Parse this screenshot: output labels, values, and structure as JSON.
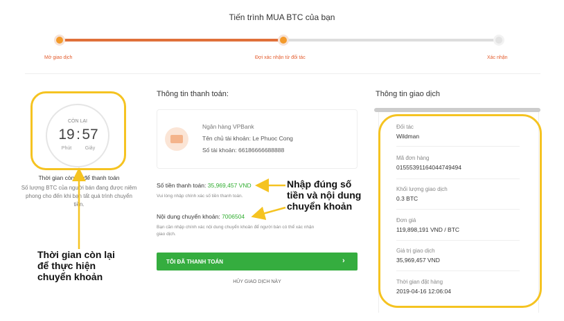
{
  "header": {
    "title": "Tiến trình MUA BTC của bạn"
  },
  "progress": {
    "fraction": 0.5,
    "steps": [
      {
        "label": "Mở giao dịch",
        "state": "done"
      },
      {
        "label": "Đợi xác nhận từ đối tác",
        "state": "current"
      },
      {
        "label": "Xác nhận",
        "state": "pending"
      }
    ]
  },
  "timer": {
    "label": "CÒN LẠI",
    "minutes": "19",
    "separator": ":",
    "seconds": "57",
    "minutes_unit": "Phút",
    "seconds_unit": "Giây",
    "heading": "Thời gian còn lại để thanh toán",
    "description": "Số lượng BTC của người bán đang được niêm phong cho đến khi bạn tất quá trình chuyển tiền."
  },
  "payment": {
    "title": "Thông tin thanh toán:",
    "bank_name": "Ngân hàng VPBank",
    "holder_label": "Tên chủ tài khoản:",
    "holder_value": "Le Phuoc Cong",
    "account_label": "Số tài khoản:",
    "account_value": "66186666688888",
    "amount_label": "Số tiền thanh toán:",
    "amount_value": "35,969,457 VND",
    "amount_note": "Vui lòng nhập chính xác số tiền thanh toán.",
    "content_label": "Nội dung chuyển khoản:",
    "content_value": "7006504",
    "content_note_1": "Bạn cần nhập chính xác nội dung chuyển khoản để người bán có thể xác nhận",
    "content_note_2": "giao dịch.",
    "pay_button": "TÔI ĐÃ THANH TOÁN",
    "pay_arrow": "›",
    "cancel_link": "HỦY GIAO DỊCH NÀY"
  },
  "transaction": {
    "title": "Thông tin giao dịch",
    "fields": [
      {
        "label": "Đối tác",
        "value": "Wildman"
      },
      {
        "label": "Mã đơn hàng",
        "value": "015553911640447494​94"
      },
      {
        "label": "Khối lượng giao dịch",
        "value": "0.3 BTC"
      },
      {
        "label": "Đơn giá",
        "value": "119,898,191 VND / BTC"
      },
      {
        "label": "Giá trị giao dịch",
        "value": "35,969,457 VND"
      },
      {
        "label": "Thời gian đặt hàng",
        "value": "2019-04-16 12:06:04"
      }
    ]
  },
  "annotations": {
    "timer_callout": [
      "Thời gian còn lại",
      "để thực hiện",
      "chuyển khoản"
    ],
    "payment_callout": [
      "Nhập đúng số",
      "tiền và nội dung",
      "chuyển khoản"
    ],
    "highlight_color": "#f5c321"
  },
  "colors": {
    "accent": "#e35b2c",
    "progress": "#e0703a",
    "button": "#35ad3f",
    "highlight": "#f5c321"
  }
}
